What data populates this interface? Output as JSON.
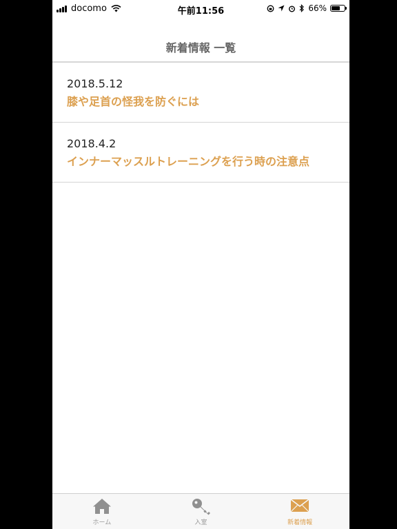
{
  "status_bar": {
    "carrier": "docomo",
    "time": "午前11:56",
    "battery_percent": "66%",
    "battery_level": 0.66
  },
  "nav": {
    "title": "新着情報 一覧"
  },
  "news_items": [
    {
      "date": "2018.5.12",
      "headline": "膝や足首の怪我を防ぐには"
    },
    {
      "date": "2018.4.2",
      "headline": "インナーマッスルトレーニングを行う時の注意点"
    }
  ],
  "tab_bar": {
    "tabs": [
      {
        "label": "ホーム",
        "icon": "home-icon",
        "active": false
      },
      {
        "label": "入室",
        "icon": "key-icon",
        "active": false
      },
      {
        "label": "新着情報",
        "icon": "envelope-icon",
        "active": true
      }
    ]
  },
  "colors": {
    "accent": "#dca050",
    "inactive_icon": "#909090",
    "title": "#666666"
  }
}
